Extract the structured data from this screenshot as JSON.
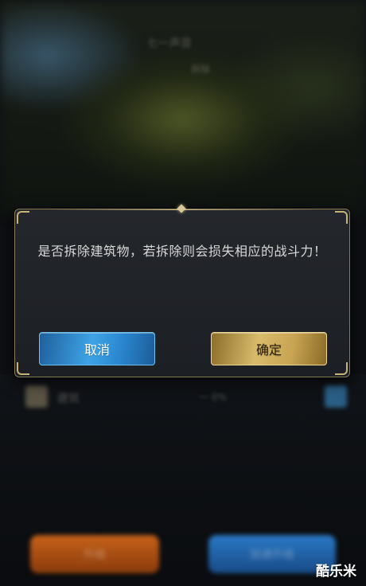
{
  "dialog": {
    "message": "是否拆除建筑物，若拆除则会损失相应的战斗力！",
    "cancel_label": "取消",
    "confirm_label": "确定"
  },
  "background": {
    "top_blur_text": "七一声音",
    "top_blur_sub": "拆除",
    "bottom_blur_label": "建筑",
    "bottom_blur_mid": "一 0%",
    "left_button": "升级",
    "right_button": "加速升级"
  },
  "watermark": "酷乐米",
  "colors": {
    "cancel": "#3ea4e6",
    "confirm": "#d9bb6c",
    "dialog_border": "#8a7b57"
  }
}
